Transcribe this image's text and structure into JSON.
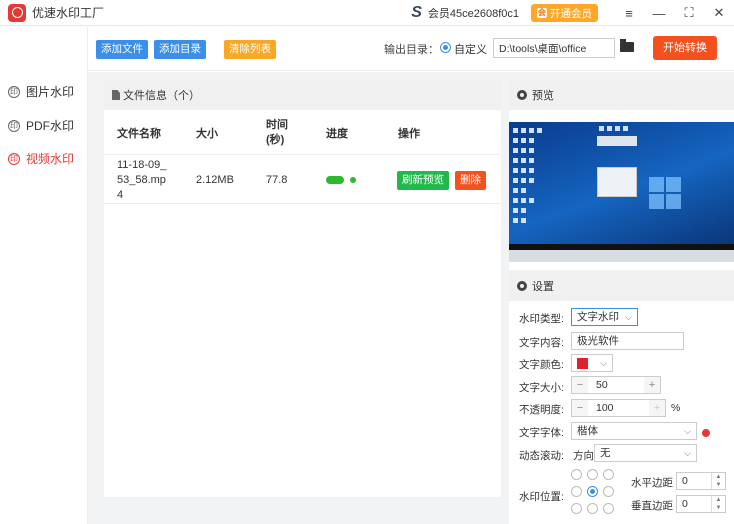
{
  "app": {
    "title": "优速水印工厂"
  },
  "titlebar": {
    "member_id": "会员45ce2608f0c1",
    "vip_label": "开通会员",
    "vip_icon": "会",
    "min_glyph": "—",
    "max_glyph": "⛶",
    "close_glyph": "✕",
    "menu_glyph": "≡"
  },
  "sidebar": {
    "items": [
      {
        "label": "图片水印",
        "active": false
      },
      {
        "label": "PDF水印",
        "active": false
      },
      {
        "label": "视频水印",
        "active": true
      }
    ]
  },
  "toolbar": {
    "add_file": "添加文件",
    "add_dir": "添加目录",
    "clear_list": "清除列表",
    "output_label": "输出目录：",
    "custom_label": "自定义",
    "output_path": "D:\\tools\\桌面\\office",
    "start": "开始转换"
  },
  "file_panel": {
    "header": "文件信息（个）",
    "columns": [
      "文件名称",
      "大小",
      "时间\n(秒)",
      "进度",
      "操作"
    ],
    "rows": [
      {
        "name": "11-18-09_\n53_58.mp\n4",
        "size": "2.12MB",
        "duration": "77.8",
        "refresh_label": "刷新预览",
        "delete_label": "删除"
      }
    ]
  },
  "preview": {
    "title": "预览"
  },
  "settings": {
    "title": "设置",
    "type_label": "水印类型:",
    "type_value": "文字水印",
    "text_label": "文字内容:",
    "text_value": "极光软件",
    "color_label": "文字颜色:",
    "color_value": "#e0202a",
    "size_label": "文字大小:",
    "size_value": "50",
    "opacity_label": "不透明度:",
    "opacity_value": "100",
    "opacity_unit": "%",
    "font_label": "文字字体:",
    "font_value": "楷体",
    "scroll_label": "动态滚动:",
    "scroll_dir_label": "方向",
    "scroll_dir_value": "无",
    "position_label": "水印位置:",
    "h_margin_label": "水平边距",
    "h_margin_value": "0",
    "v_margin_label": "垂直边距",
    "v_margin_value": "0"
  }
}
